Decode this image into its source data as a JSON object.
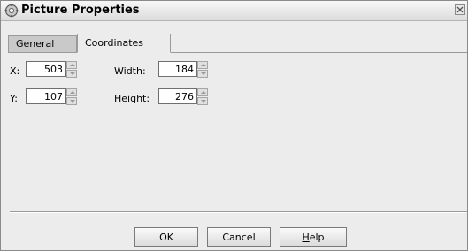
{
  "window": {
    "title": "Picture Properties",
    "icon": "gear-icon"
  },
  "tabs": [
    {
      "label": "General",
      "selected": false
    },
    {
      "label": "Coordinates",
      "selected": true
    }
  ],
  "fields": {
    "x": {
      "label": "X:",
      "value": "503"
    },
    "y": {
      "label": "Y:",
      "value": "107"
    },
    "width": {
      "label": "Width:",
      "value": "184"
    },
    "height": {
      "label": "Height:",
      "value": "276"
    }
  },
  "buttons": {
    "ok": "OK",
    "cancel": "Cancel",
    "help_mnemonic": "H",
    "help_rest": "elp"
  }
}
